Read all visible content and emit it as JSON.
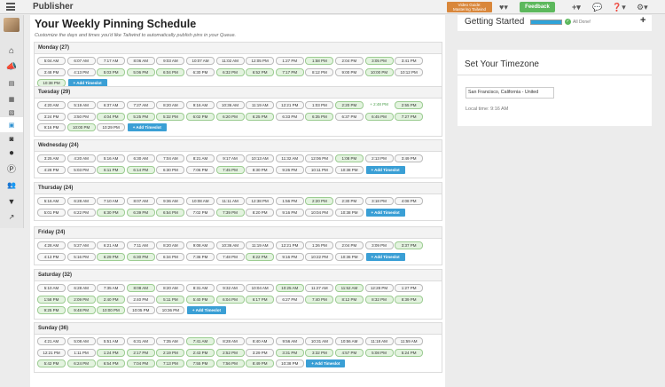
{
  "app": {
    "title": "Publisher"
  },
  "topbar": {
    "guide_line1": "Video Guide:",
    "guide_line2": "Mastering Tailwind",
    "feedback": "Feedback",
    "heart_icon": "heart-icon",
    "add_icon": "plus-icon",
    "chat_icon": "chat-icon",
    "help_icon": "help-icon",
    "settings_icon": "gear-icon"
  },
  "sidebar": {
    "items": [
      "home-icon",
      "megaphone-icon",
      "document-icon",
      "print-icon",
      "image-icon",
      "calendar-icon",
      "instagram-icon",
      "globe-icon",
      "pinterest-icon",
      "users-icon",
      "filter-icon",
      "trend-icon"
    ],
    "active_index": 5
  },
  "page": {
    "title": "Your Weekly Pinning Schedule",
    "subtitle": "Customize the days and times you'd like Tailwind to automatically publish pins in your Queue."
  },
  "add_label": "+ Add Timeslot",
  "days": [
    {
      "label": "Monday (27)",
      "slots": [
        [
          "5:04 AM",
          0
        ],
        [
          "6:07 AM",
          0
        ],
        [
          "7:17 AM",
          0
        ],
        [
          "8:06 AM",
          0
        ],
        [
          "9:03 AM",
          0
        ],
        [
          "10:07 AM",
          0
        ],
        [
          "11:02 AM",
          0
        ],
        [
          "12:05 PM",
          0
        ],
        [
          "1:27 PM",
          0
        ],
        [
          "1:58 PM",
          1
        ],
        [
          "2:04 PM",
          0
        ],
        [
          "3:05 PM",
          1
        ],
        [
          "3:41 PM",
          0
        ],
        [
          "3:48 PM",
          0
        ],
        [
          "4:13 PM",
          0
        ],
        [
          "5:03 PM",
          1
        ],
        [
          "5:06 PM",
          1
        ],
        [
          "6:04 PM",
          1
        ],
        [
          "6:30 PM",
          0
        ],
        [
          "6:32 PM",
          1
        ],
        [
          "6:52 PM",
          1
        ],
        [
          "7:17 PM",
          1
        ],
        [
          "8:12 PM",
          0
        ],
        [
          "9:00 PM",
          0
        ],
        [
          "10:00 PM",
          1
        ],
        [
          "10:12 PM",
          0
        ],
        [
          "10:38 PM",
          1
        ]
      ]
    },
    {
      "label": "Tuesday (29)",
      "slots": [
        [
          "4:20 AM",
          0
        ],
        [
          "5:19 AM",
          0
        ],
        [
          "6:37 AM",
          0
        ],
        [
          "7:27 AM",
          0
        ],
        [
          "8:20 AM",
          0
        ],
        [
          "9:16 AM",
          0
        ],
        [
          "10:36 AM",
          0
        ],
        [
          "11:19 AM",
          0
        ],
        [
          "12:21 PM",
          0
        ],
        [
          "1:03 PM",
          0
        ],
        [
          "2:20 PM",
          1
        ],
        [
          "+ 2:48 PM",
          2
        ],
        [
          "2:55 PM",
          1
        ],
        [
          "3:24 PM",
          0
        ],
        [
          "3:50 PM",
          0
        ],
        [
          "4:04 PM",
          1
        ],
        [
          "5:25 PM",
          1
        ],
        [
          "5:32 PM",
          1
        ],
        [
          "6:02 PM",
          1
        ],
        [
          "6:20 PM",
          1
        ],
        [
          "6:25 PM",
          1
        ],
        [
          "6:33 PM",
          0
        ],
        [
          "6:35 PM",
          1
        ],
        [
          "6:37 PM",
          0
        ],
        [
          "6:45 PM",
          1
        ],
        [
          "7:27 PM",
          1
        ],
        [
          "9:16 PM",
          0
        ],
        [
          "10:00 PM",
          1
        ],
        [
          "10:29 PM",
          0
        ]
      ]
    },
    {
      "label": "Wednesday (24)",
      "slots": [
        [
          "3:25 AM",
          0
        ],
        [
          "4:20 AM",
          0
        ],
        [
          "5:16 AM",
          0
        ],
        [
          "6:30 AM",
          0
        ],
        [
          "7:04 AM",
          0
        ],
        [
          "8:21 AM",
          0
        ],
        [
          "9:17 AM",
          0
        ],
        [
          "10:13 AM",
          0
        ],
        [
          "11:32 AM",
          0
        ],
        [
          "12:06 PM",
          0
        ],
        [
          "1:08 PM",
          1
        ],
        [
          "2:13 PM",
          0
        ],
        [
          "3:49 PM",
          0
        ],
        [
          "4:28 PM",
          0
        ],
        [
          "5:03 PM",
          0
        ],
        [
          "6:11 PM",
          1
        ],
        [
          "6:14 PM",
          1
        ],
        [
          "6:30 PM",
          0
        ],
        [
          "7:06 PM",
          0
        ],
        [
          "7:45 PM",
          1
        ],
        [
          "8:30 PM",
          0
        ],
        [
          "9:26 PM",
          0
        ],
        [
          "10:11 PM",
          0
        ],
        [
          "10:38 PM",
          0
        ]
      ]
    },
    {
      "label": "Thursday (24)",
      "slots": [
        [
          "5:16 AM",
          0
        ],
        [
          "6:28 AM",
          0
        ],
        [
          "7:10 AM",
          0
        ],
        [
          "8:07 AM",
          0
        ],
        [
          "9:36 AM",
          0
        ],
        [
          "10:08 AM",
          0
        ],
        [
          "11:11 AM",
          0
        ],
        [
          "12:38 PM",
          0
        ],
        [
          "1:56 PM",
          0
        ],
        [
          "2:20 PM",
          1
        ],
        [
          "2:30 PM",
          0
        ],
        [
          "3:18 PM",
          0
        ],
        [
          "4:08 PM",
          0
        ],
        [
          "5:01 PM",
          0
        ],
        [
          "6:22 PM",
          0
        ],
        [
          "6:30 PM",
          1
        ],
        [
          "6:39 PM",
          1
        ],
        [
          "6:54 PM",
          1
        ],
        [
          "7:02 PM",
          0
        ],
        [
          "7:39 PM",
          1
        ],
        [
          "8:20 PM",
          0
        ],
        [
          "9:16 PM",
          0
        ],
        [
          "10:04 PM",
          0
        ],
        [
          "10:38 PM",
          0
        ]
      ]
    },
    {
      "label": "Friday (24)",
      "slots": [
        [
          "4:28 AM",
          0
        ],
        [
          "5:27 AM",
          0
        ],
        [
          "6:21 AM",
          0
        ],
        [
          "7:11 AM",
          0
        ],
        [
          "8:20 AM",
          0
        ],
        [
          "9:08 AM",
          0
        ],
        [
          "10:36 AM",
          0
        ],
        [
          "11:19 AM",
          0
        ],
        [
          "12:21 PM",
          0
        ],
        [
          "1:26 PM",
          0
        ],
        [
          "2:04 PM",
          0
        ],
        [
          "3:09 PM",
          0
        ],
        [
          "3:37 PM",
          1
        ],
        [
          "4:13 PM",
          0
        ],
        [
          "5:16 PM",
          0
        ],
        [
          "6:29 PM",
          1
        ],
        [
          "6:30 PM",
          1
        ],
        [
          "6:34 PM",
          0
        ],
        [
          "7:36 PM",
          0
        ],
        [
          "7:48 PM",
          0
        ],
        [
          "8:22 PM",
          1
        ],
        [
          "9:16 PM",
          0
        ],
        [
          "10:22 PM",
          0
        ],
        [
          "10:36 PM",
          0
        ]
      ]
    },
    {
      "label": "Saturday (32)",
      "slots": [
        [
          "5:10 AM",
          0
        ],
        [
          "6:28 AM",
          0
        ],
        [
          "7:35 AM",
          0
        ],
        [
          "8:08 AM",
          1
        ],
        [
          "8:20 AM",
          0
        ],
        [
          "8:31 AM",
          0
        ],
        [
          "9:32 AM",
          0
        ],
        [
          "10:04 AM",
          0
        ],
        [
          "10:25 AM",
          1
        ],
        [
          "11:27 AM",
          0
        ],
        [
          "11:52 AM",
          1
        ],
        [
          "12:28 PM",
          0
        ],
        [
          "1:27 PM",
          0
        ],
        [
          "1:58 PM",
          1
        ],
        [
          "2:09 PM",
          1
        ],
        [
          "2:40 PM",
          1
        ],
        [
          "2:40 PM",
          0
        ],
        [
          "5:11 PM",
          1
        ],
        [
          "5:40 PM",
          1
        ],
        [
          "6:04 PM",
          1
        ],
        [
          "6:17 PM",
          1
        ],
        [
          "6:27 PM",
          0
        ],
        [
          "7:40 PM",
          1
        ],
        [
          "8:12 PM",
          1
        ],
        [
          "8:32 PM",
          1
        ],
        [
          "8:39 PM",
          1
        ],
        [
          "9:25 PM",
          1
        ],
        [
          "9:48 PM",
          1
        ],
        [
          "10:00 PM",
          1
        ],
        [
          "10:05 PM",
          0
        ],
        [
          "10:36 PM",
          0
        ]
      ]
    },
    {
      "label": "Sunday (36)",
      "slots": [
        [
          "4:21 AM",
          0
        ],
        [
          "5:08 AM",
          0
        ],
        [
          "5:51 AM",
          0
        ],
        [
          "6:31 AM",
          0
        ],
        [
          "7:35 AM",
          0
        ],
        [
          "7:41 AM",
          1
        ],
        [
          "8:28 AM",
          0
        ],
        [
          "8:40 AM",
          0
        ],
        [
          "9:56 AM",
          0
        ],
        [
          "10:31 AM",
          0
        ],
        [
          "10:56 AM",
          0
        ],
        [
          "11:18 AM",
          0
        ],
        [
          "11:59 AM",
          0
        ],
        [
          "12:21 PM",
          0
        ],
        [
          "1:11 PM",
          0
        ],
        [
          "1:24 PM",
          1
        ],
        [
          "2:17 PM",
          1
        ],
        [
          "2:19 PM",
          1
        ],
        [
          "2:43 PM",
          1
        ],
        [
          "2:52 PM",
          1
        ],
        [
          "3:29 PM",
          0
        ],
        [
          "3:31 PM",
          1
        ],
        [
          "3:32 PM",
          1
        ],
        [
          "4:57 PM",
          1
        ],
        [
          "5:08 PM",
          1
        ],
        [
          "5:24 PM",
          1
        ],
        [
          "5:42 PM",
          1
        ],
        [
          "6:24 PM",
          1
        ],
        [
          "6:54 PM",
          1
        ],
        [
          "7:04 PM",
          1
        ],
        [
          "7:13 PM",
          1
        ],
        [
          "7:55 PM",
          1
        ],
        [
          "7:56 PM",
          1
        ],
        [
          "8:49 PM",
          1
        ],
        [
          "10:38 PM",
          0
        ]
      ]
    }
  ],
  "getting_started": {
    "title": "Getting Started",
    "progress": 1.0,
    "status": "All Done!"
  },
  "timezone": {
    "title": "Set Your Timezone",
    "selected": "San Francisco, California - United",
    "local_time": "Local time: 9:16 AM"
  }
}
